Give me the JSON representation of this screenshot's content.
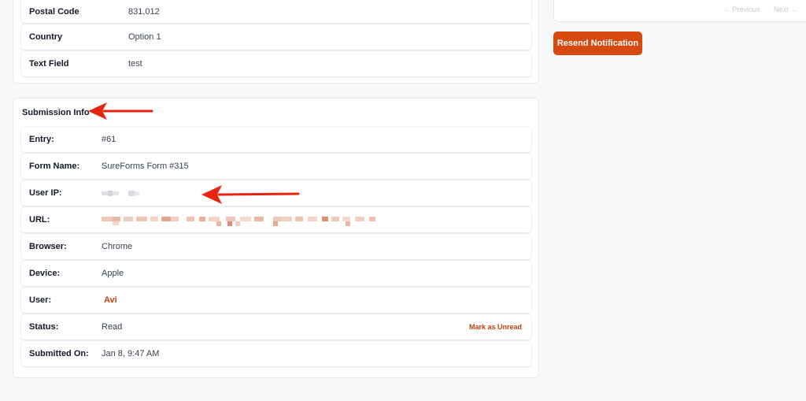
{
  "top_card": {
    "rows": [
      {
        "label": "Postal Code",
        "value": "831,012"
      },
      {
        "label": "Country",
        "value": "Option 1"
      },
      {
        "label": "Text Field",
        "value": "test"
      }
    ]
  },
  "submission_info": {
    "title": "Submission Info",
    "rows": [
      {
        "label": "Entry:",
        "value": "#61"
      },
      {
        "label": "Form Name:",
        "value": "SureForms Form #315"
      },
      {
        "label": "User IP:",
        "value": ""
      },
      {
        "label": "URL:",
        "value": ""
      },
      {
        "label": "Browser:",
        "value": "Chrome"
      },
      {
        "label": "Device:",
        "value": "Apple"
      },
      {
        "label": "User:",
        "value": "Avi"
      },
      {
        "label": "Status:",
        "value": "Read",
        "action": "Mark as Unread"
      },
      {
        "label": "Submitted On:",
        "value": "Jan 8, 9:47 AM"
      }
    ]
  },
  "pager": {
    "previous_label": "Previous",
    "next_label": "Next"
  },
  "actions": {
    "resend_label": "Resend Notification"
  },
  "icons": {
    "previous": "arrow-left-icon",
    "next": "arrow-right-icon",
    "annotation": "red-arrow-icon"
  },
  "colors": {
    "accent": "#d6490f",
    "link": "#c2410c",
    "annotation_arrow": "#e8230f",
    "background": "#f6f8fa"
  }
}
